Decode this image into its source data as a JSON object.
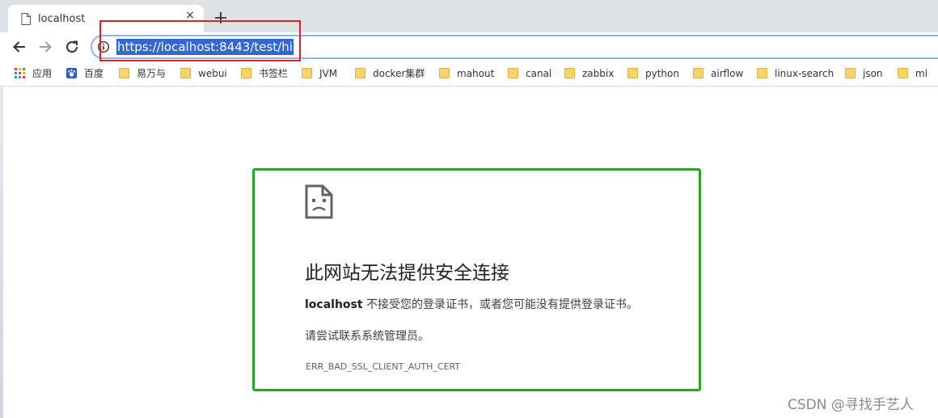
{
  "tab": {
    "title": "localhost",
    "close_glyph": "×",
    "icon": "document-icon"
  },
  "toolbar": {
    "url": "https://localhost:8443/test/hi"
  },
  "bookmarks": [
    {
      "label": "应用",
      "icon": "apps-icon"
    },
    {
      "label": "百度",
      "icon": "baidu-icon"
    },
    {
      "label": "易万与",
      "icon": "folder-icon"
    },
    {
      "label": "webui",
      "icon": "folder-icon"
    },
    {
      "label": "书签栏",
      "icon": "folder-icon"
    },
    {
      "label": "JVM",
      "icon": "folder-icon"
    },
    {
      "label": "docker集群",
      "icon": "folder-icon"
    },
    {
      "label": "mahout",
      "icon": "folder-icon"
    },
    {
      "label": "canal",
      "icon": "folder-icon"
    },
    {
      "label": "zabbix",
      "icon": "folder-icon"
    },
    {
      "label": "python",
      "icon": "folder-icon"
    },
    {
      "label": "airflow",
      "icon": "folder-icon"
    },
    {
      "label": "linux-search",
      "icon": "folder-icon"
    },
    {
      "label": "json",
      "icon": "folder-icon"
    },
    {
      "label": "ml",
      "icon": "folder-icon"
    }
  ],
  "error": {
    "heading": "此网站无法提供安全连接",
    "host": "localhost",
    "description": " 不接受您的登录证书，或者您可能没有提供登录证书。",
    "suggestion": "请尝试联系系统管理员。",
    "code": "ERR_BAD_SSL_CLIENT_AUTH_CERT"
  },
  "watermark": "CSDN @寻找手艺人",
  "colors": {
    "annotation_red": "#e02020",
    "annotation_green": "#2ca52c",
    "url_selection": "#3367d6"
  }
}
